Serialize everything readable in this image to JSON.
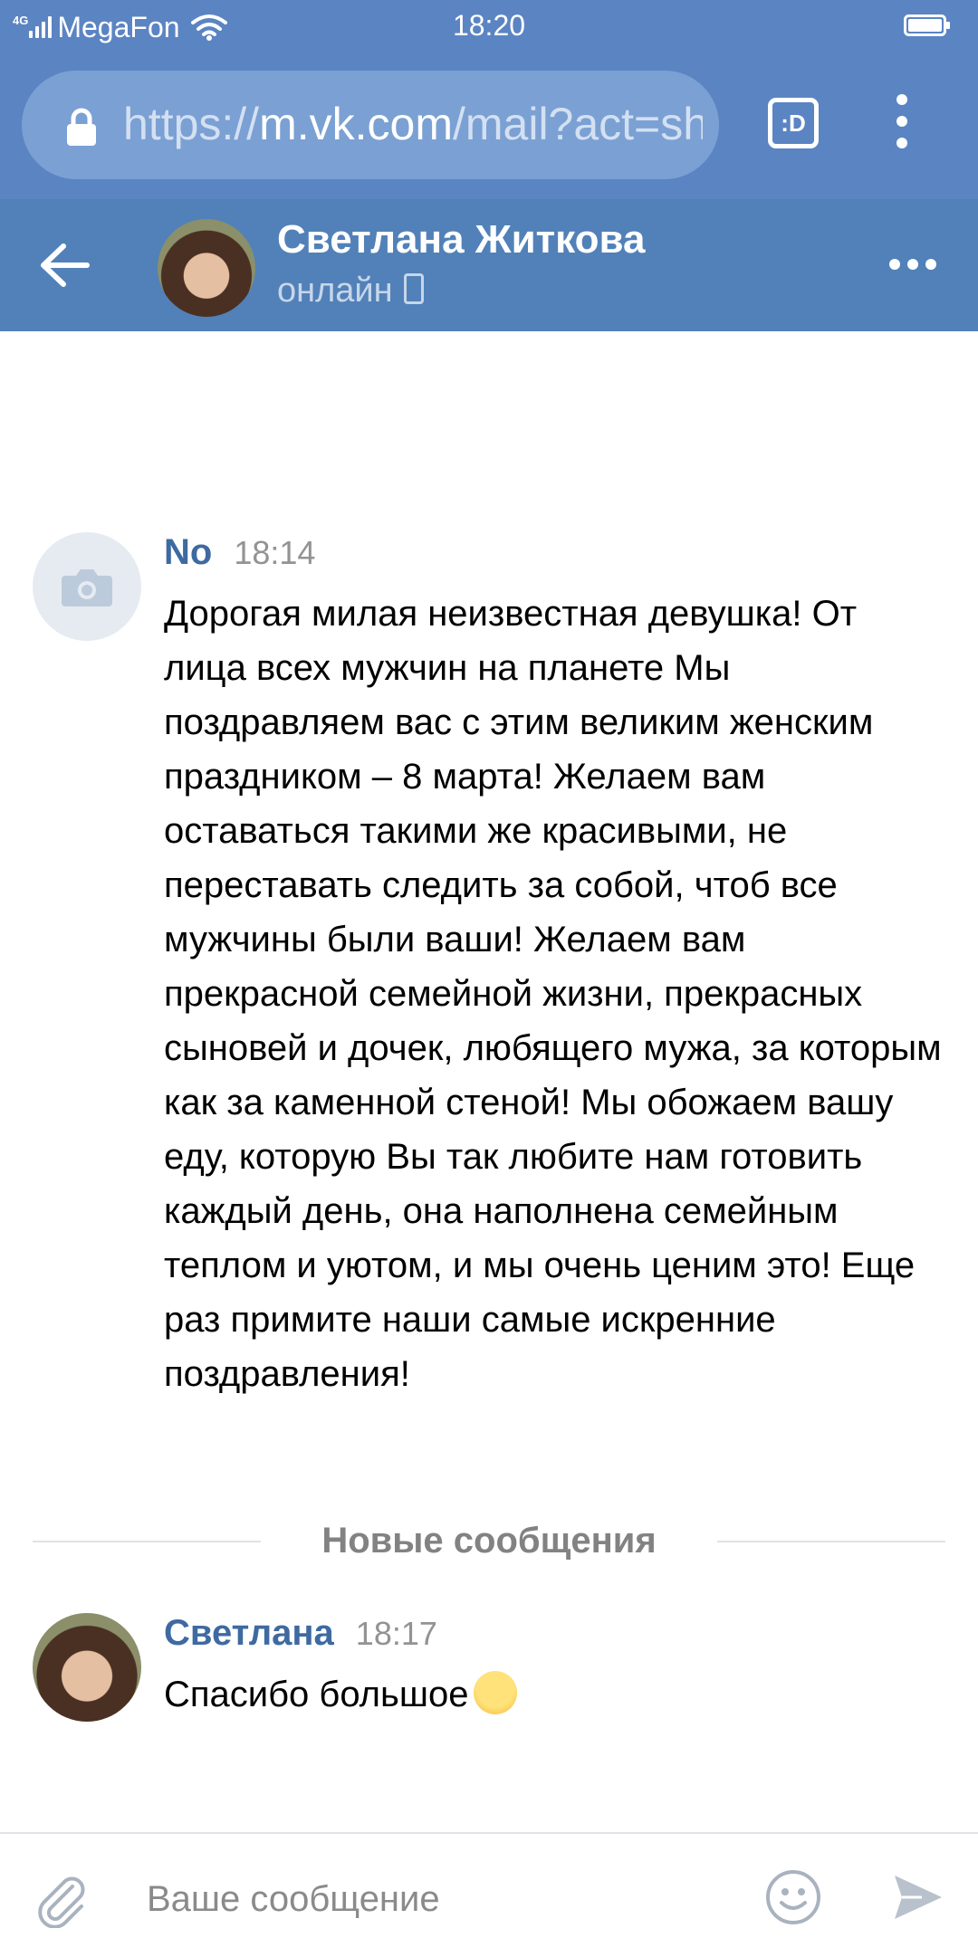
{
  "statusbar": {
    "network": "4G",
    "carrier": "MegaFon",
    "time": "18:20"
  },
  "browser": {
    "url_scheme": "https://",
    "url_host": "m.vk.com",
    "url_path": "/mail?act=sh",
    "tabs_label": ":D"
  },
  "header": {
    "name": "Светлана Житкова",
    "status": "онлайн"
  },
  "messages": [
    {
      "author": "No",
      "time": "18:14",
      "text": "Дорогая милая неизвестная девушка! От лица всех мужчин на планете Мы поздравляем вас с этим великим женским праздником – 8 марта! Желаем вам оставаться такими же красивыми, не переставать следить за собой, чтоб все мужчины были ваши! Желаем вам прекрасной семейной жизни, прекрасных сыновей и дочек, любящего мужа, за которым как за каменной стеной! Мы обожаем вашу еду, которую Вы так любите нам готовить каждый день, она наполнена семейным теплом и уютом, и мы очень ценим это! Еще раз примите наши самые искренние поздравления!"
    },
    {
      "author": "Светлана",
      "time": "18:17",
      "text": "Спасибо большое",
      "emoji": "smiling-face-emoji"
    }
  ],
  "divider": {
    "label": "Новые сообщения"
  },
  "input": {
    "placeholder": "Ваше сообщение",
    "value": ""
  },
  "icons": {
    "lock": "lock-icon",
    "back": "back-arrow-icon",
    "more": "more-icon",
    "attach": "paperclip-icon",
    "emoji": "smile-icon",
    "send": "send-icon",
    "camera": "camera-icon"
  },
  "colors": {
    "header_bg": "#5181b8",
    "browser_bg": "#5b84c3",
    "author_link": "#3e6aa1",
    "time_grey": "#939393"
  }
}
